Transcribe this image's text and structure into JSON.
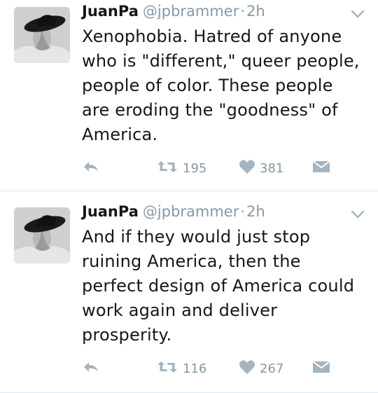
{
  "tweets": [
    {
      "name": "JuanPa",
      "handle": "@jpbrammer",
      "separator": "·",
      "time": "2h",
      "text": "Xenophobia. Hatred of anyone who is \"different,\" queer people, people of color. These people are eroding the \"goodness\" of America.",
      "retweets": "195",
      "likes": "381",
      "icons": [
        "reply-icon",
        "retweet-icon",
        "like-icon",
        "direct-message-icon",
        "chevron-down-icon"
      ]
    },
    {
      "name": "JuanPa",
      "handle": "@jpbrammer",
      "separator": "·",
      "time": "2h",
      "text": "And if they would just stop ruining America, then the perfect design of America could work again and deliver prosperity.",
      "retweets": "116",
      "likes": "267",
      "icons": [
        "reply-icon",
        "retweet-icon",
        "like-icon",
        "direct-message-icon",
        "chevron-down-icon"
      ]
    }
  ],
  "colors": {
    "text": "#14171a",
    "secondary": "#8899a6",
    "icon": "#a4b4c0",
    "divider": "#e1e8ed"
  }
}
